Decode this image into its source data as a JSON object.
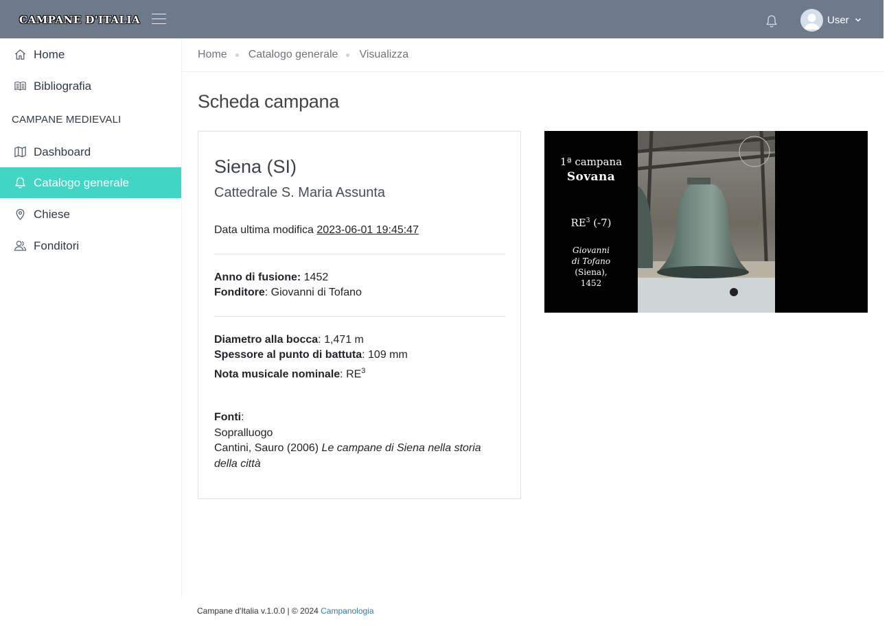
{
  "header": {
    "brand": "CAMPANE D'ITALIA",
    "user_label": "User"
  },
  "sidebar": {
    "items": [
      {
        "label": "Home",
        "icon": "home-icon"
      },
      {
        "label": "Bibliografia",
        "icon": "book-icon"
      },
      {
        "label": "Dashboard",
        "icon": "map-icon"
      },
      {
        "label": "Catalogo generale",
        "icon": "bell-icon",
        "active": true
      },
      {
        "label": "Chiese",
        "icon": "location-pin-icon"
      },
      {
        "label": "Fonditori",
        "icon": "users-icon"
      }
    ],
    "section_label": "CAMPANE MEDIEVALI"
  },
  "breadcrumb": [
    "Home",
    "Catalogo generale",
    "Visualizza"
  ],
  "page": {
    "title": "Scheda campana"
  },
  "card": {
    "city": "Siena (SI)",
    "church": "Cattedrale S. Maria Assunta",
    "modified_label": "Data ultima modifica",
    "modified_value": "2023-06-01 19:45:47",
    "anno_label": "Anno di fusione:",
    "anno_value": "1452",
    "fonditore_label": "Fonditore",
    "fonditore_value": ": Giovanni di Tofano",
    "diametro_label": "Diametro alla bocca",
    "diametro_value": ": 1,471 m",
    "spessore_label": "Spessore al punto di battuta",
    "spessore_value": ": 109 mm",
    "nota_label": "Nota musicale nominale",
    "nota_value": ": RE",
    "nota_sup": "3",
    "fonti_label": "Fonti",
    "fonti_colon": ":",
    "fonti_1": "Sopralluogo",
    "fonti_2_author": "Cantini, Sauro (2006)",
    "fonti_2_title": "Le campane di Siena nella storia della città"
  },
  "photo": {
    "line1": "1ª campana",
    "line2": "Sovana",
    "line3_note": "RE",
    "line3_sup": "3",
    "line3_rest": " (-7)",
    "line4a": "Giovanni",
    "line4b": "di Tofano",
    "line5a": "(Siena),",
    "line5b": "1452"
  },
  "footer": {
    "text": "Campane d'Italia v.1.0.0 | © 2024 ",
    "link": "Campanologia"
  },
  "colors": {
    "topbar": "#6c7a89",
    "active_nav": "#41d6c3",
    "link": "#2f7fb1"
  }
}
